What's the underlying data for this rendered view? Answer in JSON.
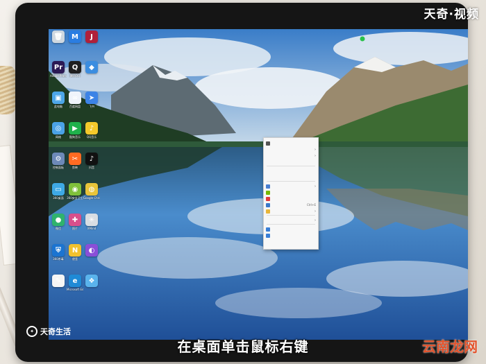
{
  "watermarks": {
    "top_right": "天奇·视频",
    "bottom_left": "天奇生活",
    "bottom_right": "云南龙网"
  },
  "subtitle": "在桌面单击鼠标右键",
  "desktop_icons": [
    {
      "name": "recycle-bin",
      "label": "",
      "color": "#cfd8e0",
      "glyph": "🗑"
    },
    {
      "name": "maxthon",
      "label": "",
      "color": "#2a7de1",
      "glyph": "M"
    },
    {
      "name": "app-red",
      "label": "",
      "color": "#b0203a",
      "glyph": "J"
    },
    {
      "name": "premiere",
      "label": "Adobe Premiere",
      "color": "#2b1a55",
      "glyph": "Pr"
    },
    {
      "name": "qq-penguin",
      "label": "腾讯QQ",
      "color": "#1f1f1f",
      "glyph": "Q"
    },
    {
      "name": "app-blue",
      "label": "",
      "color": "#3b8de0",
      "glyph": "◆"
    },
    {
      "name": "computer",
      "label": "此电脑",
      "color": "#4da6e8",
      "glyph": "▣"
    },
    {
      "name": "baidu-netdisk",
      "label": "百度网盘",
      "color": "#f0f4fb",
      "glyph": "∞"
    },
    {
      "name": "feishu",
      "label": "飞书",
      "color": "#3c83e6",
      "glyph": "➤"
    },
    {
      "name": "network",
      "label": "网络",
      "color": "#4aa2e6",
      "glyph": "◎"
    },
    {
      "name": "kugou",
      "label": "酷狗音乐",
      "color": "#1fb14b",
      "glyph": "▶"
    },
    {
      "name": "qqmusic",
      "label": "QQ音乐",
      "color": "#f4c92b",
      "glyph": "♪"
    },
    {
      "name": "control-panel",
      "label": "控制面板",
      "color": "#6d89b8",
      "glyph": "⚙"
    },
    {
      "name": "jianying",
      "label": "剪映",
      "color": "#ff6b22",
      "glyph": "✂"
    },
    {
      "name": "douyin",
      "label": "抖音",
      "color": "#111",
      "glyph": "♪"
    },
    {
      "name": "monitor-app",
      "label": "360桌面",
      "color": "#3ea9e5",
      "glyph": "▭"
    },
    {
      "name": "360",
      "label": "360安全卫士",
      "color": "#7fc13a",
      "glyph": "◉"
    },
    {
      "name": "chrome",
      "label": "Google Chrome",
      "color": "#e8c43a",
      "glyph": "◍"
    },
    {
      "name": "wechat",
      "label": "微信",
      "color": "#2fb36d",
      "glyph": "●"
    },
    {
      "name": "photos",
      "label": "照片",
      "color": "#d94f8b",
      "glyph": "✚"
    },
    {
      "name": "xmind",
      "label": "XMind",
      "color": "#d8dde3",
      "glyph": "✳"
    },
    {
      "name": "shield",
      "label": "360杀毒",
      "color": "#1b74d1",
      "glyph": "⛨"
    },
    {
      "name": "note",
      "label": "便签",
      "color": "#f2c12e",
      "glyph": "N"
    },
    {
      "name": "color-app",
      "label": "",
      "color": "#8a4fd8",
      "glyph": "◐"
    },
    {
      "name": "pen-app",
      "label": "",
      "color": "#f5f5f5",
      "glyph": "✎"
    },
    {
      "name": "edge",
      "label": "Microsoft Edge",
      "color": "#1f8ad6",
      "glyph": "e"
    },
    {
      "name": "app-sky",
      "label": "",
      "color": "#5ab3ec",
      "glyph": "❖"
    }
  ],
  "context_menu": [
    {
      "label": "",
      "arrow": false,
      "color": "#555",
      "disabled": false
    },
    {
      "label": "",
      "arrow": true,
      "color": "",
      "disabled": false
    },
    {
      "label": "",
      "arrow": true,
      "color": "",
      "disabled": false
    },
    {
      "label": "",
      "arrow": false,
      "color": "",
      "disabled": false
    },
    {
      "sep": true
    },
    {
      "label": "",
      "arrow": false,
      "color": "",
      "disabled": true
    },
    {
      "label": "",
      "arrow": false,
      "color": "",
      "disabled": true
    },
    {
      "sep": true
    },
    {
      "label": "",
      "arrow": true,
      "color": "#4a7fd0",
      "disabled": false
    },
    {
      "label": "",
      "arrow": false,
      "color": "#76b900",
      "disabled": false
    },
    {
      "label": "",
      "arrow": false,
      "color": "#e03a3a",
      "disabled": false
    },
    {
      "label": "",
      "arrow": false,
      "color": "#3a78c9",
      "disabled": false,
      "shortcut": "Ctrl+E"
    },
    {
      "label": "",
      "arrow": true,
      "color": "#e8b53a",
      "disabled": false
    },
    {
      "sep": true
    },
    {
      "label": "",
      "arrow": true,
      "color": "",
      "disabled": false
    },
    {
      "sep": true
    },
    {
      "label": "",
      "arrow": false,
      "color": "#3a7fd6",
      "disabled": false
    },
    {
      "label": "",
      "arrow": false,
      "color": "#3a7fd6",
      "disabled": false
    }
  ]
}
